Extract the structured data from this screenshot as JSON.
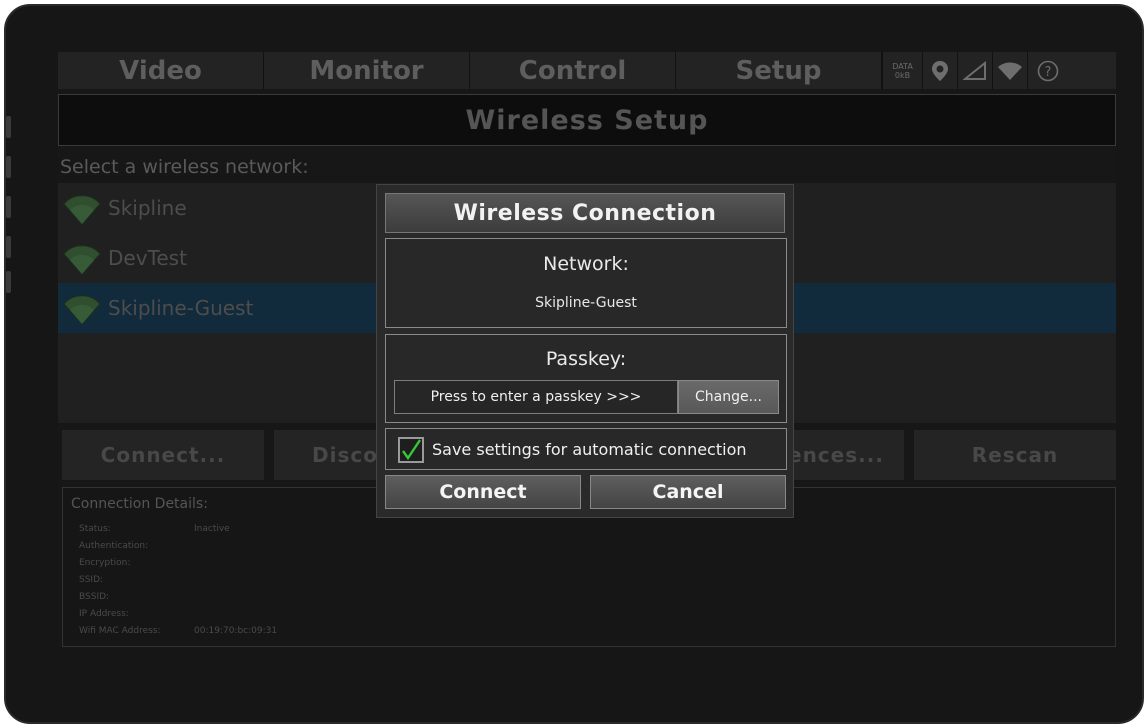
{
  "nav": {
    "tabs": [
      "Video",
      "Monitor",
      "Control",
      "Setup"
    ],
    "data_indicator": {
      "label": "DATA",
      "value": "0kB"
    },
    "status_icons": [
      "location-pin-icon",
      "signal-strength-icon",
      "wifi-icon",
      "help-icon"
    ]
  },
  "page": {
    "title": "Wireless Setup",
    "select_label": "Select a wireless network:"
  },
  "networks": [
    {
      "name": "Skipline",
      "selected": false
    },
    {
      "name": "DevTest",
      "selected": false
    },
    {
      "name": "Skipline-Guest",
      "selected": true
    }
  ],
  "background_buttons": {
    "connect": "Connect...",
    "disconnect": "Disco",
    "preferences": "ences...",
    "rescan": "Rescan"
  },
  "details": {
    "title": "Connection Details:",
    "rows": [
      {
        "label": "Status:",
        "value": "Inactive"
      },
      {
        "label": "Authentication:",
        "value": ""
      },
      {
        "label": "Encryption:",
        "value": ""
      },
      {
        "label": "SSID:",
        "value": ""
      },
      {
        "label": "BSSID:",
        "value": ""
      },
      {
        "label": "IP Address:",
        "value": ""
      },
      {
        "label": "Wifi  MAC Address:",
        "value": "00:19:70:bc:09:31"
      }
    ]
  },
  "dialog": {
    "title": "Wireless Connection",
    "network_label": "Network:",
    "network_value": "Skipline-Guest",
    "passkey_label": "Passkey:",
    "passkey_placeholder": "Press to enter a passkey >>>",
    "change_button": "Change...",
    "save_checkbox_label": "Save settings for automatic connection",
    "save_checked": true,
    "connect_button": "Connect",
    "cancel_button": "Cancel"
  },
  "colors": {
    "selected_row": "#112a3c",
    "checkmark": "#37c837",
    "wifi_icon": "#2f4f2f"
  }
}
